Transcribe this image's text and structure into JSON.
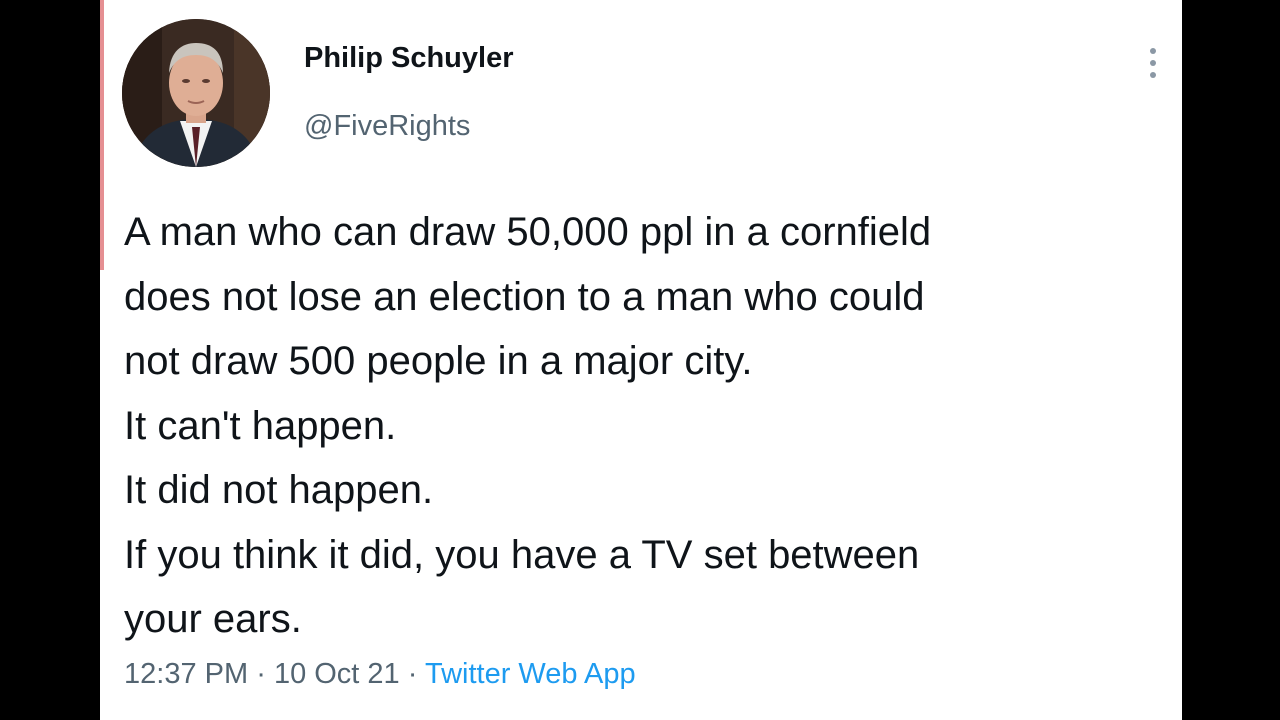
{
  "tweet": {
    "author": {
      "display_name": "Philip Schuyler",
      "handle": "@FiveRights",
      "avatar_icon": "portrait-photo"
    },
    "more_icon": "more-vertical-icon",
    "text_lines": [
      "A man who can draw 50,000 ppl in a cornfield",
      "does not lose an election to a man who could",
      "not draw 500 people in a major city.",
      "It can't happen.",
      "It did not happen.",
      "If you think it did, you have a TV set between",
      "your ears."
    ],
    "meta": {
      "time": "12:37 PM",
      "separator": "·",
      "date": "10 Oct 21",
      "source": "Twitter Web App"
    }
  },
  "colors": {
    "background": "#000000",
    "card": "#ffffff",
    "text": "#0f1419",
    "secondary_text": "#536471",
    "link": "#1d9bf0"
  }
}
